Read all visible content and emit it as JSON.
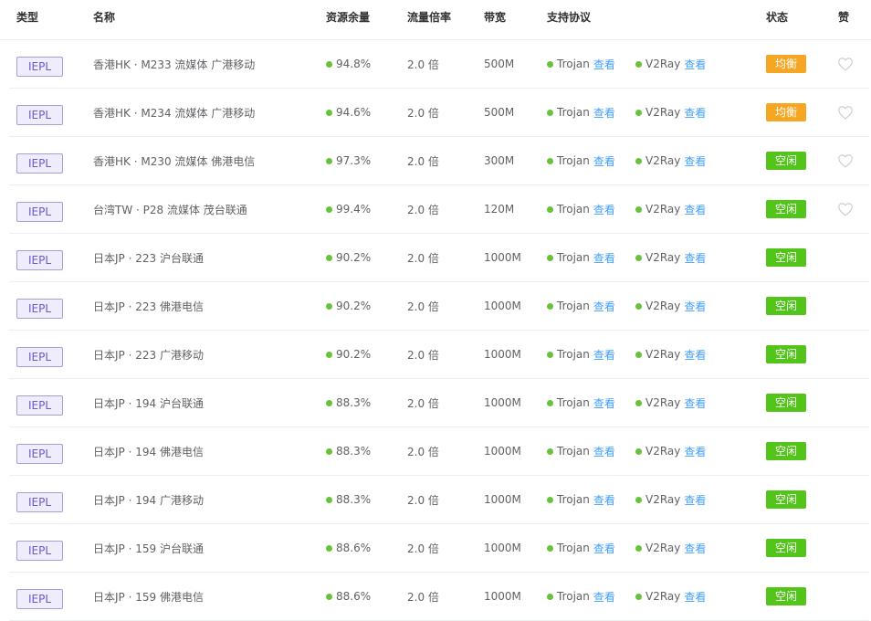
{
  "headers": {
    "type": "类型",
    "name": "名称",
    "resource": "资源余量",
    "rate": "流量倍率",
    "bandwidth": "带宽",
    "protocol": "支持协议",
    "status": "状态",
    "like": "赞"
  },
  "colors": {
    "balanced": "#f5a623",
    "idle": "#52c41a",
    "link": "#409eff",
    "dot": "#67c23a",
    "type_tag_border": "#a99cd8",
    "type_tag_bg": "#efedfb"
  },
  "rows": [
    {
      "type": "IEPL",
      "name": "香港HK · M233 流媒体 广港移动",
      "resource": "94.8%",
      "rate": "2.0 倍",
      "bandwidth": "500M",
      "proto1": "Trojan",
      "proto1_link": "查看",
      "proto2": "V2Ray",
      "proto2_link": "查看",
      "status": "均衡",
      "status_kind": "balanced",
      "like_icon": "heart-outline-icon"
    },
    {
      "type": "IEPL",
      "name": "香港HK · M234 流媒体 广港移动",
      "resource": "94.6%",
      "rate": "2.0 倍",
      "bandwidth": "500M",
      "proto1": "Trojan",
      "proto1_link": "查看",
      "proto2": "V2Ray",
      "proto2_link": "查看",
      "status": "均衡",
      "status_kind": "balanced",
      "like_icon": "heart-outline-icon"
    },
    {
      "type": "IEPL",
      "name": "香港HK · M230 流媒体 佛港电信",
      "resource": "97.3%",
      "rate": "2.0 倍",
      "bandwidth": "300M",
      "proto1": "Trojan",
      "proto1_link": "查看",
      "proto2": "V2Ray",
      "proto2_link": "查看",
      "status": "空闲",
      "status_kind": "idle",
      "like_icon": "heart-outline-icon"
    },
    {
      "type": "IEPL",
      "name": "台湾TW · P28 流媒体 茂台联通",
      "resource": "99.4%",
      "rate": "2.0 倍",
      "bandwidth": "120M",
      "proto1": "Trojan",
      "proto1_link": "查看",
      "proto2": "V2Ray",
      "proto2_link": "查看",
      "status": "空闲",
      "status_kind": "idle",
      "like_icon": "heart-outline-icon"
    },
    {
      "type": "IEPL",
      "name": "日本JP · 223 沪台联通",
      "resource": "90.2%",
      "rate": "2.0 倍",
      "bandwidth": "1000M",
      "proto1": "Trojan",
      "proto1_link": "查看",
      "proto2": "V2Ray",
      "proto2_link": "查看",
      "status": "空闲",
      "status_kind": "idle",
      "like_icon": ""
    },
    {
      "type": "IEPL",
      "name": "日本JP · 223 佛港电信",
      "resource": "90.2%",
      "rate": "2.0 倍",
      "bandwidth": "1000M",
      "proto1": "Trojan",
      "proto1_link": "查看",
      "proto2": "V2Ray",
      "proto2_link": "查看",
      "status": "空闲",
      "status_kind": "idle",
      "like_icon": ""
    },
    {
      "type": "IEPL",
      "name": "日本JP · 223 广港移动",
      "resource": "90.2%",
      "rate": "2.0 倍",
      "bandwidth": "1000M",
      "proto1": "Trojan",
      "proto1_link": "查看",
      "proto2": "V2Ray",
      "proto2_link": "查看",
      "status": "空闲",
      "status_kind": "idle",
      "like_icon": ""
    },
    {
      "type": "IEPL",
      "name": "日本JP · 194 沪台联通",
      "resource": "88.3%",
      "rate": "2.0 倍",
      "bandwidth": "1000M",
      "proto1": "Trojan",
      "proto1_link": "查看",
      "proto2": "V2Ray",
      "proto2_link": "查看",
      "status": "空闲",
      "status_kind": "idle",
      "like_icon": ""
    },
    {
      "type": "IEPL",
      "name": "日本JP · 194 佛港电信",
      "resource": "88.3%",
      "rate": "2.0 倍",
      "bandwidth": "1000M",
      "proto1": "Trojan",
      "proto1_link": "查看",
      "proto2": "V2Ray",
      "proto2_link": "查看",
      "status": "空闲",
      "status_kind": "idle",
      "like_icon": ""
    },
    {
      "type": "IEPL",
      "name": "日本JP · 194 广港移动",
      "resource": "88.3%",
      "rate": "2.0 倍",
      "bandwidth": "1000M",
      "proto1": "Trojan",
      "proto1_link": "查看",
      "proto2": "V2Ray",
      "proto2_link": "查看",
      "status": "空闲",
      "status_kind": "idle",
      "like_icon": ""
    },
    {
      "type": "IEPL",
      "name": "日本JP · 159 沪台联通",
      "resource": "88.6%",
      "rate": "2.0 倍",
      "bandwidth": "1000M",
      "proto1": "Trojan",
      "proto1_link": "查看",
      "proto2": "V2Ray",
      "proto2_link": "查看",
      "status": "空闲",
      "status_kind": "idle",
      "like_icon": ""
    },
    {
      "type": "IEPL",
      "name": "日本JP · 159 佛港电信",
      "resource": "88.6%",
      "rate": "2.0 倍",
      "bandwidth": "1000M",
      "proto1": "Trojan",
      "proto1_link": "查看",
      "proto2": "V2Ray",
      "proto2_link": "查看",
      "status": "空闲",
      "status_kind": "idle",
      "like_icon": ""
    }
  ]
}
